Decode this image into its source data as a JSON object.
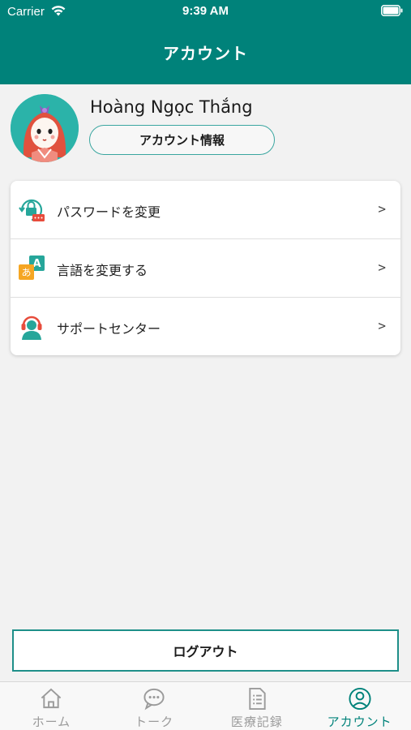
{
  "status_bar": {
    "carrier": "Carrier",
    "time": "9:39 AM"
  },
  "header": {
    "title": "アカウント"
  },
  "profile": {
    "name": "Hoàng Ngọc Thắng",
    "account_info_label": "アカウント情報"
  },
  "menu": {
    "items": [
      {
        "label": "パスワードを変更",
        "icon": "password-lock-icon",
        "chevron": ">"
      },
      {
        "label": "言語を変更する",
        "icon": "language-icon",
        "chevron": ">"
      },
      {
        "label": "サポートセンター",
        "icon": "support-headset-icon",
        "chevron": ">"
      }
    ]
  },
  "logout_label": "ログアウト",
  "tabs": [
    {
      "label": "ホーム",
      "icon": "home-icon",
      "active": false
    },
    {
      "label": "トーク",
      "icon": "chat-icon",
      "active": false
    },
    {
      "label": "医療記録",
      "icon": "document-icon",
      "active": false
    },
    {
      "label": "アカウント",
      "icon": "account-icon",
      "active": true
    }
  ],
  "colors": {
    "primary": "#00827a",
    "inactive": "#9b9b9b",
    "background": "#f2f2f2"
  }
}
